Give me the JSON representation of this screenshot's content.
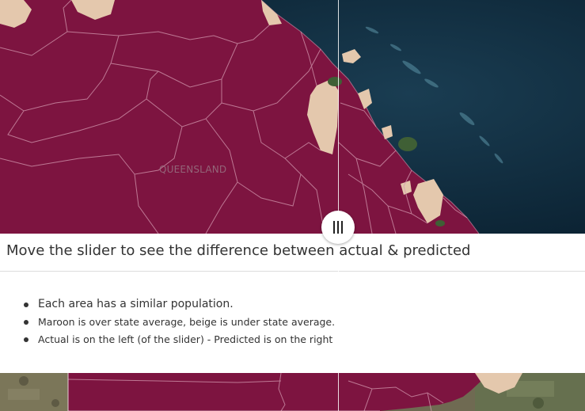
{
  "map": {
    "region_label": "QUEENSLAND",
    "colors": {
      "over_average": "#7d1440",
      "under_average": "#e4c8ad",
      "ocean": "#0f2a3d",
      "reef": "#6fa5b6",
      "boundary": "#d49ab0"
    }
  },
  "slider": {
    "handle_icon": "vertical-grip-icon"
  },
  "panel": {
    "title": "Move the slider to see the difference between actual & predicted",
    "bullets": [
      "Each area has a similar population.",
      "Maroon is over state average, beige is under state average.",
      "Actual is on the left (of the slider) - Predicted is on the right"
    ]
  }
}
